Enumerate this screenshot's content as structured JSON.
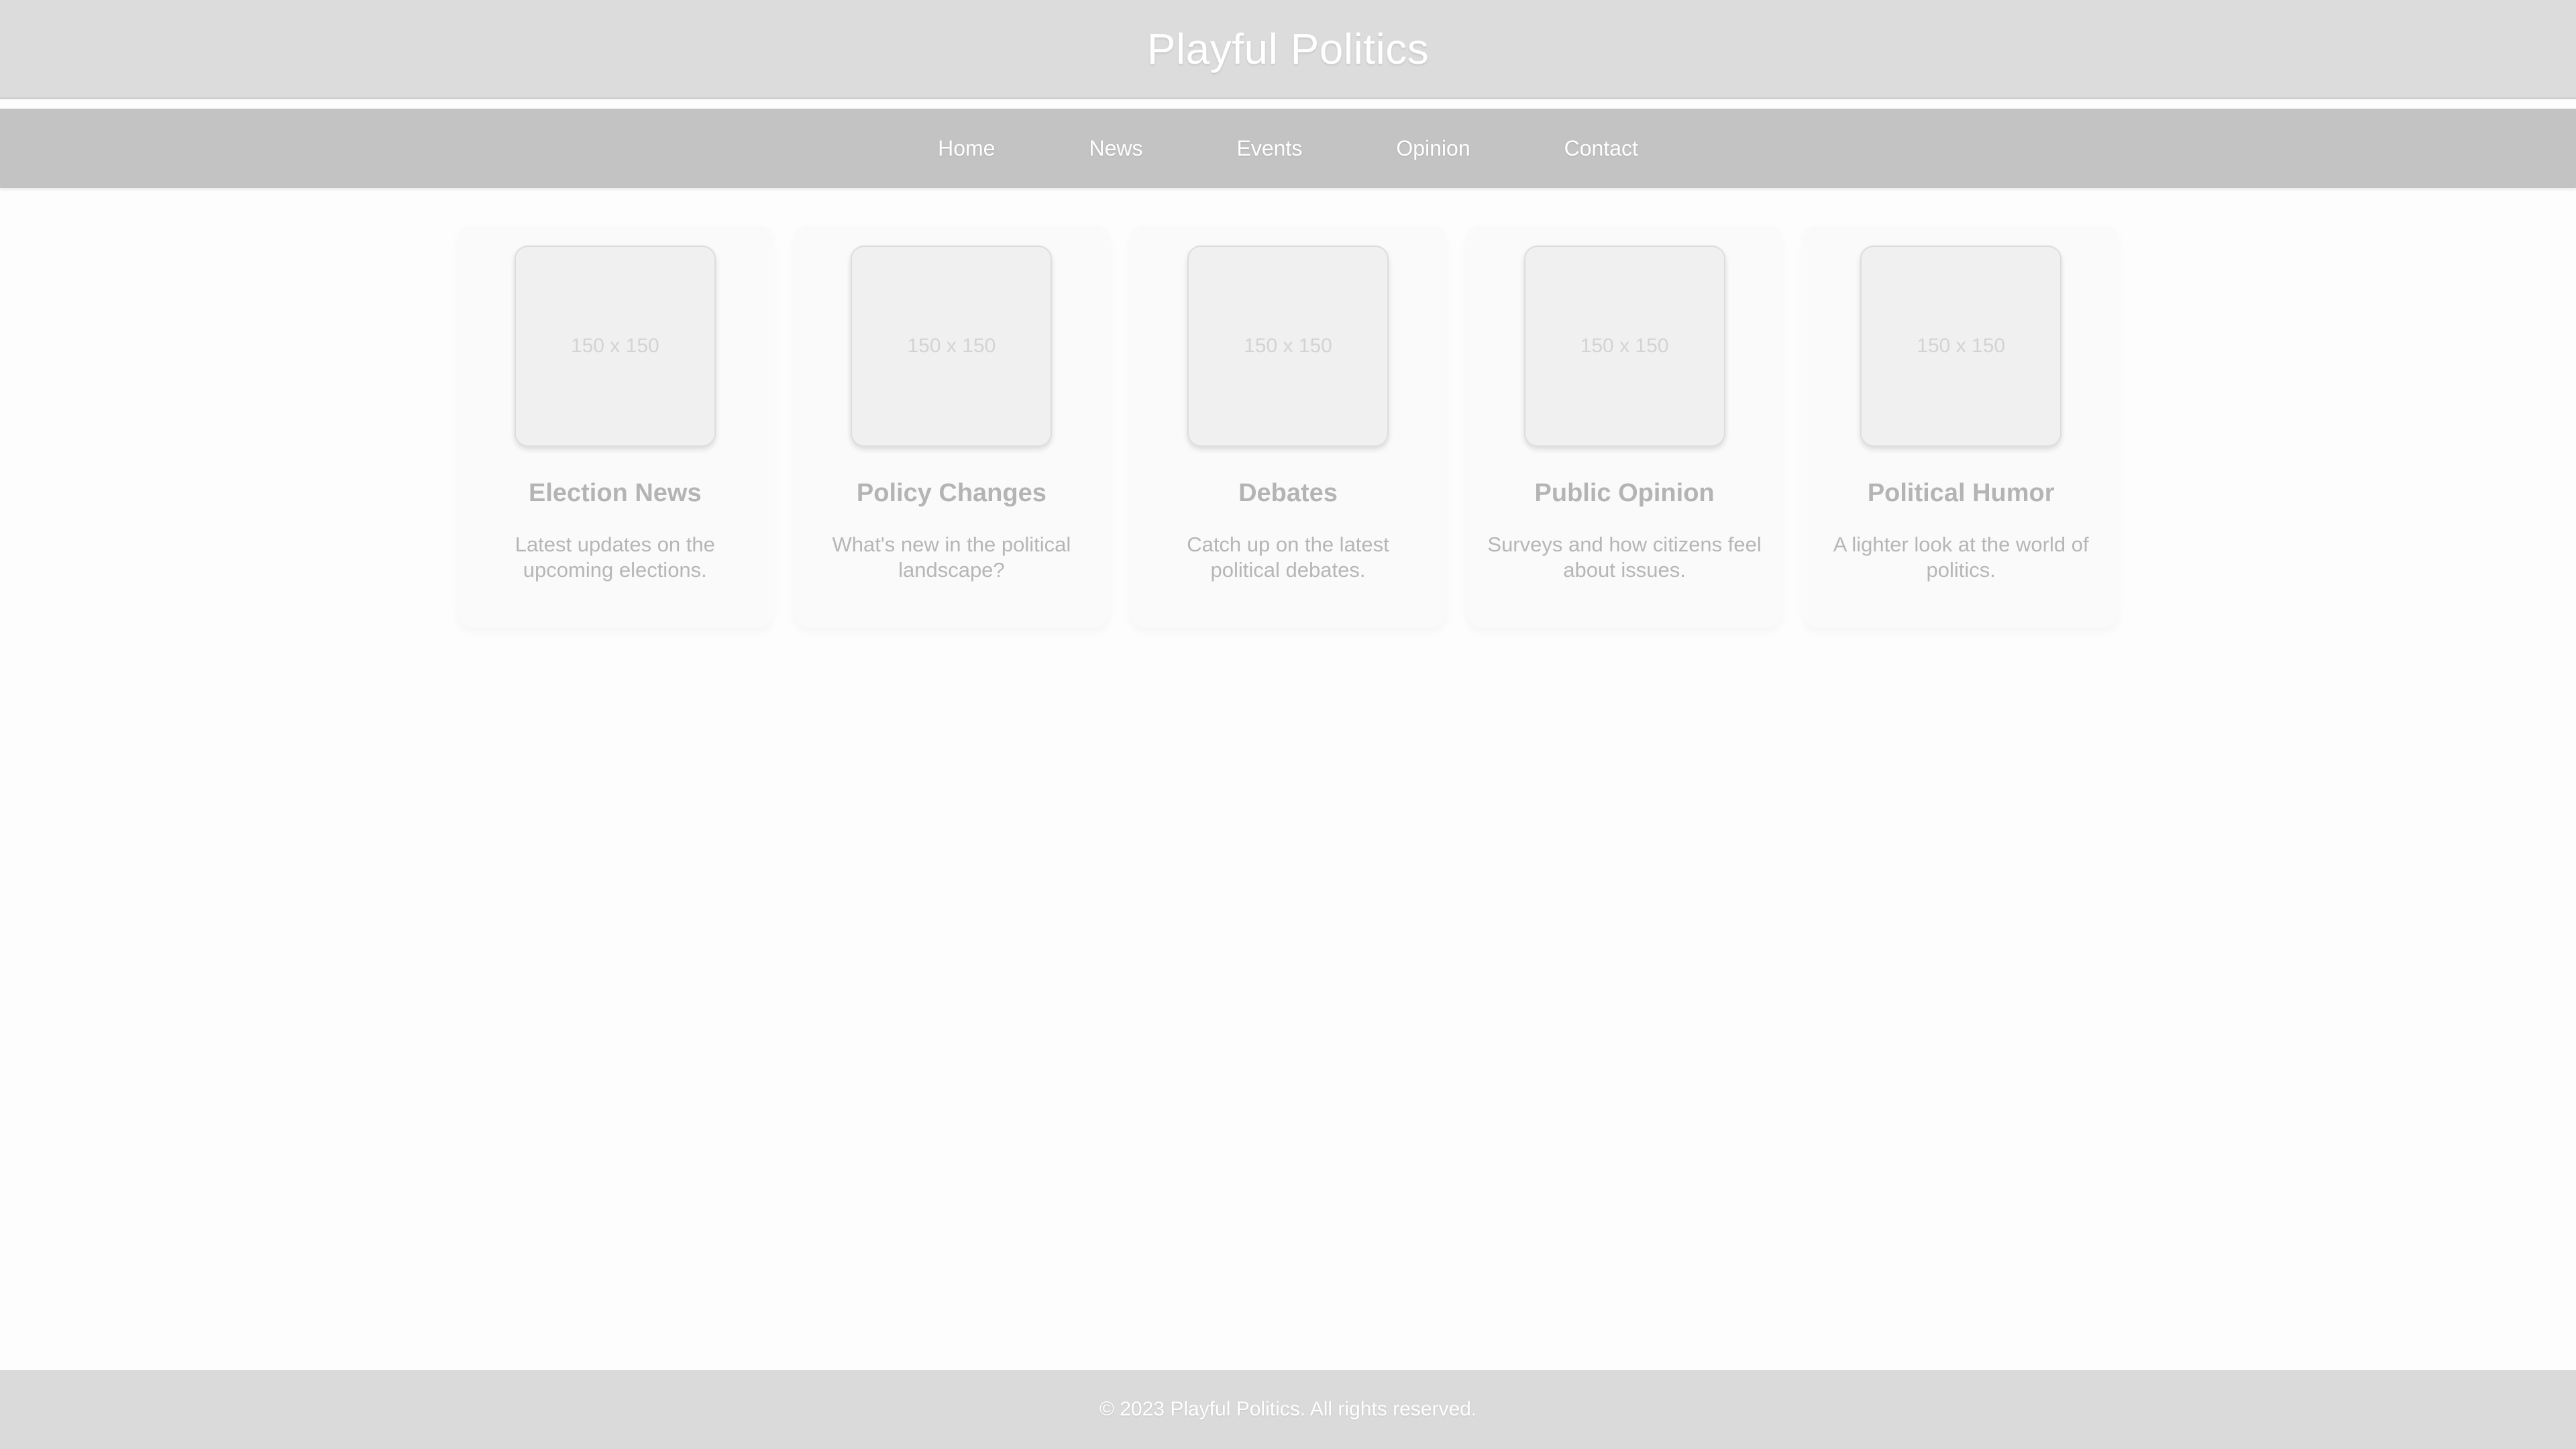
{
  "header": {
    "title": "Playful Politics"
  },
  "nav": {
    "items": [
      {
        "label": "Home"
      },
      {
        "label": "News"
      },
      {
        "label": "Events"
      },
      {
        "label": "Opinion"
      },
      {
        "label": "Contact"
      }
    ]
  },
  "cards": [
    {
      "image_text": "150 x 150",
      "title": "Election News",
      "description": "Latest updates on the upcoming elections."
    },
    {
      "image_text": "150 x 150",
      "title": "Policy Changes",
      "description": "What's new in the political landscape?"
    },
    {
      "image_text": "150 x 150",
      "title": "Debates",
      "description": "Catch up on the latest political debates."
    },
    {
      "image_text": "150 x 150",
      "title": "Public Opinion",
      "description": "Surveys and how citizens feel about issues."
    },
    {
      "image_text": "150 x 150",
      "title": "Political Humor",
      "description": "A lighter look at the world of politics."
    }
  ],
  "footer": {
    "copyright": "© 2023 Playful Politics. All rights reserved."
  },
  "colors": {
    "header_bg": "#dcdcdc",
    "nav_bg": "#c3c3c3",
    "footer_bg": "#dadada",
    "card_bg": "#fafafa",
    "text_light": "#ffffff",
    "text_muted": "#b4b4b4"
  }
}
